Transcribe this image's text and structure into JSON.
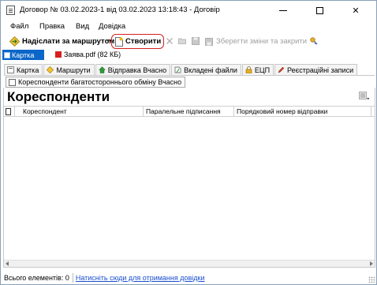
{
  "window": {
    "title": "Договор № 03.02.2023-1 від 03.02.2023 13:18:43 - Договір",
    "minimize": "minimize",
    "maximize": "maximize",
    "close": "✕"
  },
  "menu": {
    "items": [
      {
        "label": "Файл"
      },
      {
        "label": "Правка"
      },
      {
        "label": "Вид"
      },
      {
        "label": "Довідка"
      }
    ]
  },
  "toolbar": {
    "send_route_label": "Надіслати за маршрутом",
    "create_label": "Створити",
    "save_close_label": "Зберегти зміни та закрити"
  },
  "attachments": {
    "card_tab_label": "Картка",
    "pdf_label": "Заява.pdf (82 КБ)"
  },
  "tabs": [
    {
      "label": "Картка"
    },
    {
      "label": "Маршрути"
    },
    {
      "label": "Відправка Вчасно"
    },
    {
      "label": "Вкладені файли"
    },
    {
      "label": "ЕЦП"
    },
    {
      "label": "Реєстраційні записи"
    }
  ],
  "subtab": {
    "label": "Кореспонденти багатостороннього обміну Вчасно"
  },
  "section": {
    "title": "Кореспонденти",
    "columns": [
      {
        "label": "Кореспондент"
      },
      {
        "label": "Паралельне підписання"
      },
      {
        "label": "Порядковий номер відправки"
      }
    ],
    "rows": []
  },
  "status": {
    "count_label": "Всього елементів: 0",
    "help_link": "Натисніть сюди для отримання довідки"
  },
  "colors": {
    "accent": "#0a66c8",
    "highlight_border": "#d32020",
    "link": "#1a4fd0"
  }
}
